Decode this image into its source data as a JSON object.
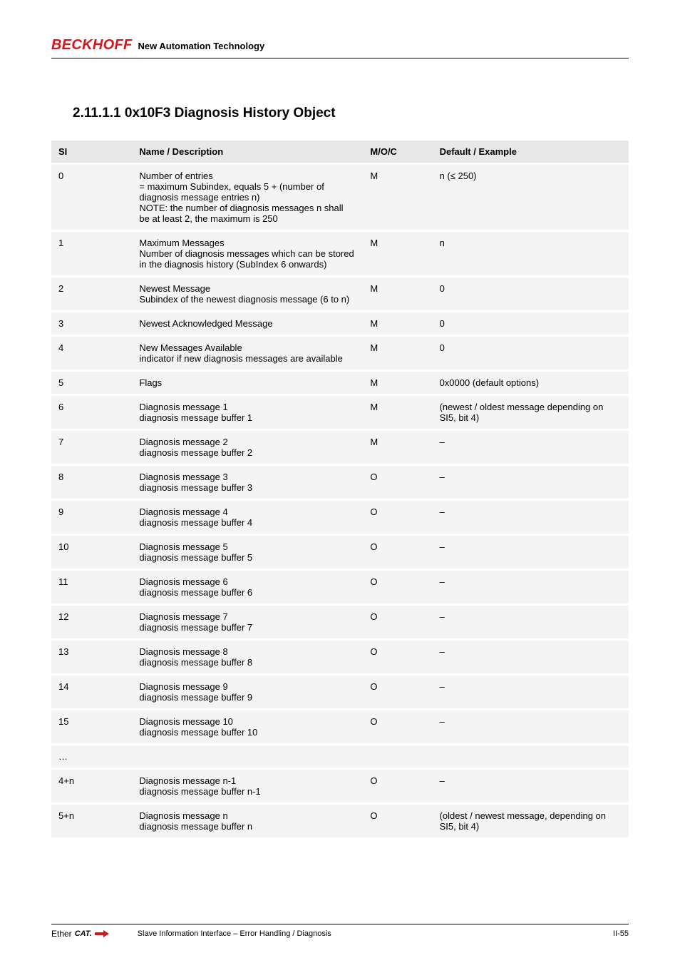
{
  "header": {
    "brand": "BECKHOFF",
    "tagline": "New Automation Technology"
  },
  "section": {
    "title": "2.11.1.1 0x10F3 Diagnosis History Object"
  },
  "table": {
    "headers": {
      "index": "SI",
      "name": "Name / Description",
      "flags": "M/O/C",
      "default": "Default / Example"
    },
    "rows": [
      {
        "index": "0",
        "name": "Number of entries\n= maximum Subindex, equals 5 + (number of diagnosis message entries n)\nNOTE: the number of diagnosis messages n shall be at least 2, the maximum is 250",
        "flags": "M",
        "default": "n (≤ 250)"
      },
      {
        "index": "1",
        "name": "Maximum Messages\nNumber of diagnosis messages which can be stored in the diagnosis history (SubIndex 6 onwards)",
        "flags": "M",
        "default": "n"
      },
      {
        "index": "2",
        "name": "Newest Message\nSubindex of the newest diagnosis message (6 to n)",
        "flags": "M",
        "default": "0"
      },
      {
        "index": "3",
        "name": "Newest Acknowledged Message",
        "flags": "M",
        "default": "0"
      },
      {
        "index": "4",
        "name": "New Messages Available\nindicator if new diagnosis messages are available",
        "flags": "M",
        "default": "0"
      },
      {
        "index": "5",
        "name": "Flags",
        "flags": "M",
        "default": "0x0000 (default options)"
      },
      {
        "index": "6",
        "name": "Diagnosis message 1\ndiagnosis message buffer 1",
        "flags": "M",
        "default": "(newest / oldest message depending on SI5, bit 4)"
      },
      {
        "index": "7",
        "name": "Diagnosis message 2\ndiagnosis message buffer 2",
        "flags": "M",
        "default": "–"
      },
      {
        "index": "8",
        "name": "Diagnosis message 3\ndiagnosis message buffer 3",
        "flags": "O",
        "default": "–"
      },
      {
        "index": "9",
        "name": "Diagnosis message 4\ndiagnosis message buffer 4",
        "flags": "O",
        "default": "–"
      },
      {
        "index": "10",
        "name": "Diagnosis message 5\ndiagnosis message buffer 5",
        "flags": "O",
        "default": "–"
      },
      {
        "index": "11",
        "name": "Diagnosis message 6\ndiagnosis message buffer 6",
        "flags": "O",
        "default": "–"
      },
      {
        "index": "12",
        "name": "Diagnosis message 7\ndiagnosis message buffer 7",
        "flags": "O",
        "default": "–"
      },
      {
        "index": "13",
        "name": "Diagnosis message 8\ndiagnosis message buffer 8",
        "flags": "O",
        "default": "–"
      },
      {
        "index": "14",
        "name": "Diagnosis message 9\ndiagnosis message buffer 9",
        "flags": "O",
        "default": "–"
      },
      {
        "index": "15",
        "name": "Diagnosis message 10\ndiagnosis message buffer 10",
        "flags": "O",
        "default": "–"
      },
      {
        "index": "…",
        "name": "",
        "flags": "",
        "default": ""
      },
      {
        "index": "4+n",
        "name": "Diagnosis message n-1\ndiagnosis message buffer n-1",
        "flags": "O",
        "default": "–"
      },
      {
        "index": "5+n",
        "name": "Diagnosis message n\ndiagnosis message buffer n",
        "flags": "O",
        "default": "(oldest / newest message, depending on SI5, bit 4)"
      }
    ]
  },
  "footer": {
    "logo_prefix": "Ether",
    "logo_suffix": "CAT.",
    "center": "Slave Information Interface – Error Handling / Diagnosis",
    "right": "II-55"
  }
}
